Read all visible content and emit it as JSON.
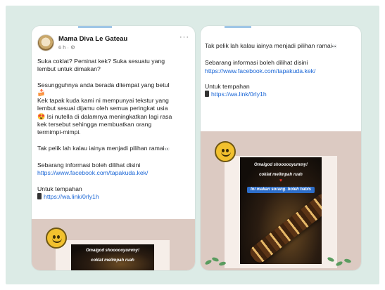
{
  "left_post": {
    "author": "Mama Diva Le Gateau",
    "meta": "6 h · ⚙",
    "more": "···",
    "lines": [
      "Suka coklat? Peminat kek? Suka sesuatu yang",
      "lembut untuk dimakan?",
      "",
      "Sesungguhnya anda berada ditempat yang betul",
      "Kek tapak kuda kami ni mempunyai tekstur yang",
      "lembut sesuai dijamu oleh semua peringkat usia",
      "Isi nutella di dalamnya meningkatkan lagi rasa",
      "kek tersebut sehingga membuatkan orang",
      "termimpi-mimpi.",
      "",
      "Tak pelik lah kalau iainya menjadi pilihan ramai",
      "",
      "Sebarang informasi boleh dilihat disini",
      "https://www.facebook.com/tapakuda.kek/",
      "",
      "Untuk tempahan",
      "https://wa.link/0rly1h"
    ],
    "image_text": {
      "title": "Omaigod shoooooyummy!",
      "subtitle": "coklat melimpah ruah"
    }
  },
  "right_post": {
    "lines": [
      "Tak pelik lah kalau iainya menjadi pilihan ramai",
      "",
      "Sebarang informasi boleh dilihat disini",
      "https://www.facebook.com/tapakuda.kek/",
      "",
      "Untuk tempahan",
      "https://wa.link/0rly1h"
    ],
    "image_text": {
      "title": "Omaigod shoooooyummy!",
      "subtitle": "coklat melimpah ruah",
      "note": "Ini makan sorang. boleh habis"
    }
  },
  "colors": {
    "backdrop": "#dcebe6",
    "link": "#1a66d6",
    "image_bg": "#dccac2"
  },
  "icons": {
    "emoji_cake": "🍰",
    "emoji_heart_eyes": "😍",
    "emoji_eyes": "👀",
    "phone": "mobile-phone-icon"
  }
}
